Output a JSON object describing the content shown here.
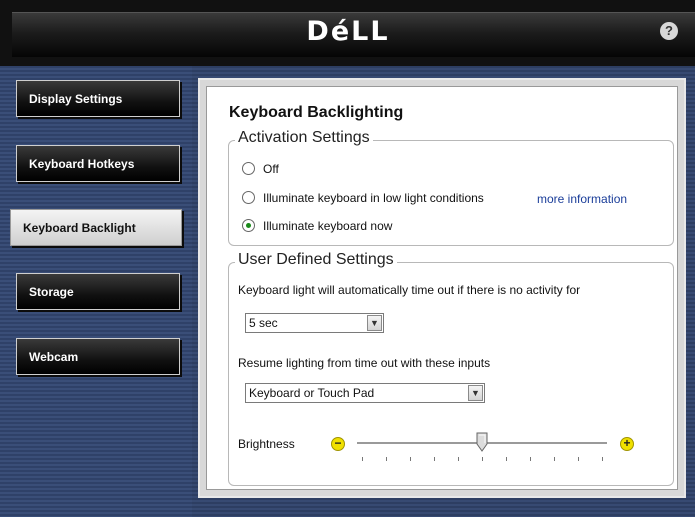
{
  "header": {
    "logo": "DéLL",
    "help": "?"
  },
  "nav": {
    "items": [
      {
        "label": "Display Settings"
      },
      {
        "label": "Keyboard Hotkeys"
      },
      {
        "label": "Keyboard Backlight"
      },
      {
        "label": "Storage"
      },
      {
        "label": "Webcam"
      }
    ],
    "active_index": 2
  },
  "main": {
    "title": "Keyboard Backlighting",
    "activation": {
      "legend": "Activation Settings",
      "options": [
        {
          "label": "Off",
          "checked": false
        },
        {
          "label": "Illuminate keyboard in low light conditions",
          "checked": false
        },
        {
          "label": "Illuminate keyboard now",
          "checked": true
        }
      ],
      "more_info_link": "more information"
    },
    "user_defined": {
      "legend": "User Defined Settings",
      "timeout_label": "Keyboard light will automatically time out if there is no activity for",
      "timeout_value": "5 sec",
      "resume_label": "Resume lighting from time out with these inputs",
      "resume_value": "Keyboard or Touch Pad",
      "brightness_label": "Brightness",
      "brightness_minus": "−",
      "brightness_plus": "+",
      "brightness_level": 0.5
    }
  },
  "colors": {
    "accent_link": "#1a3d99",
    "slider_button": "#f0e000",
    "checked_radio": "#1a8a1a"
  }
}
